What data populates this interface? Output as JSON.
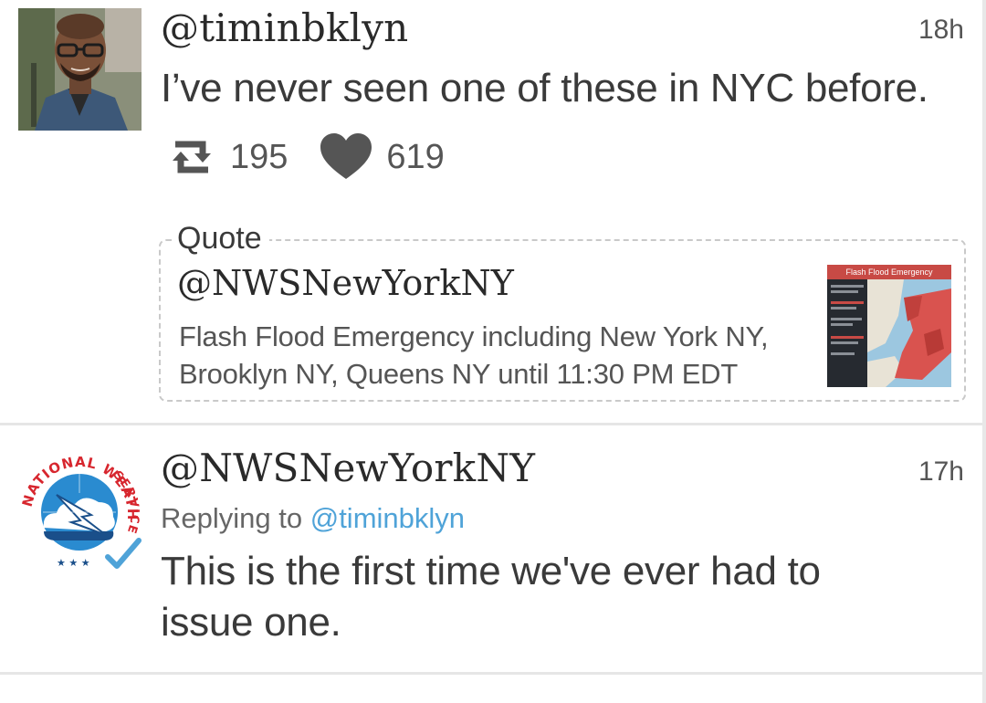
{
  "tweets": [
    {
      "handle": "@timinbklyn",
      "time": "18h",
      "text": "I’ve never seen one of these in NYC before.",
      "stats": {
        "retweets": "195",
        "likes": "619"
      },
      "avatar": "profile-photo",
      "quote": {
        "label": "Quote",
        "handle": "@NWSNewYorkNY",
        "text_line1": "Flash Flood Emergency including New York NY,",
        "text_line2": "Brooklyn NY, Queens NY until 11:30 PM EDT",
        "thumbnail_title": "Flash Flood Emergency"
      }
    },
    {
      "handle": "@NWSNewYorkNY",
      "time": "17h",
      "reply_prefix": "Replying to ",
      "reply_to": "@timinbklyn",
      "text_line1": "This is the first time we've ever had to",
      "text_line2": "issue one.",
      "avatar": "national-weather-service-logo",
      "logo_text": "NATIONAL WEATHER SERVICE"
    }
  ],
  "icons": {
    "retweet": "retweet-icon",
    "like": "heart-icon",
    "verified": "checkmark-icon"
  },
  "colors": {
    "link": "#4fa3d8",
    "icon": "#555555",
    "divider": "#e6e6e6",
    "quote_border": "#c9c9c9",
    "flood_red": "#c84a45"
  }
}
